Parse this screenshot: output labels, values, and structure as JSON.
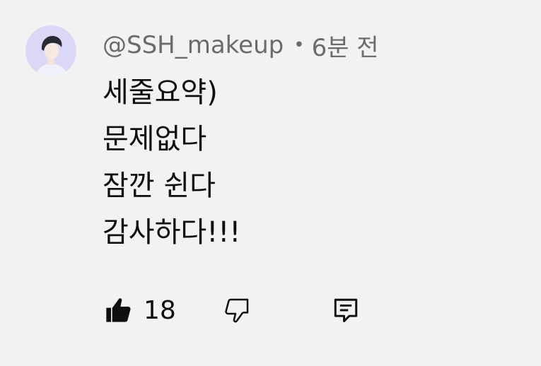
{
  "comment": {
    "author": "@SSH_makeup",
    "separator": "•",
    "time": "6분 전",
    "lines": [
      "세줄요약)",
      "문제없다",
      "잠깐 쉰다",
      "감사하다!!!"
    ],
    "like_count": "18"
  },
  "icons": {
    "avatar": "avatar",
    "like": "thumbs-up-filled-icon",
    "dislike": "thumbs-down-outline-icon",
    "reply": "comment-reply-icon"
  },
  "colors": {
    "background": "#f2f2f2",
    "meta_text": "#6b6b6b",
    "body_text": "#0f0f0f",
    "avatar_bg": "#dcd6f7"
  }
}
